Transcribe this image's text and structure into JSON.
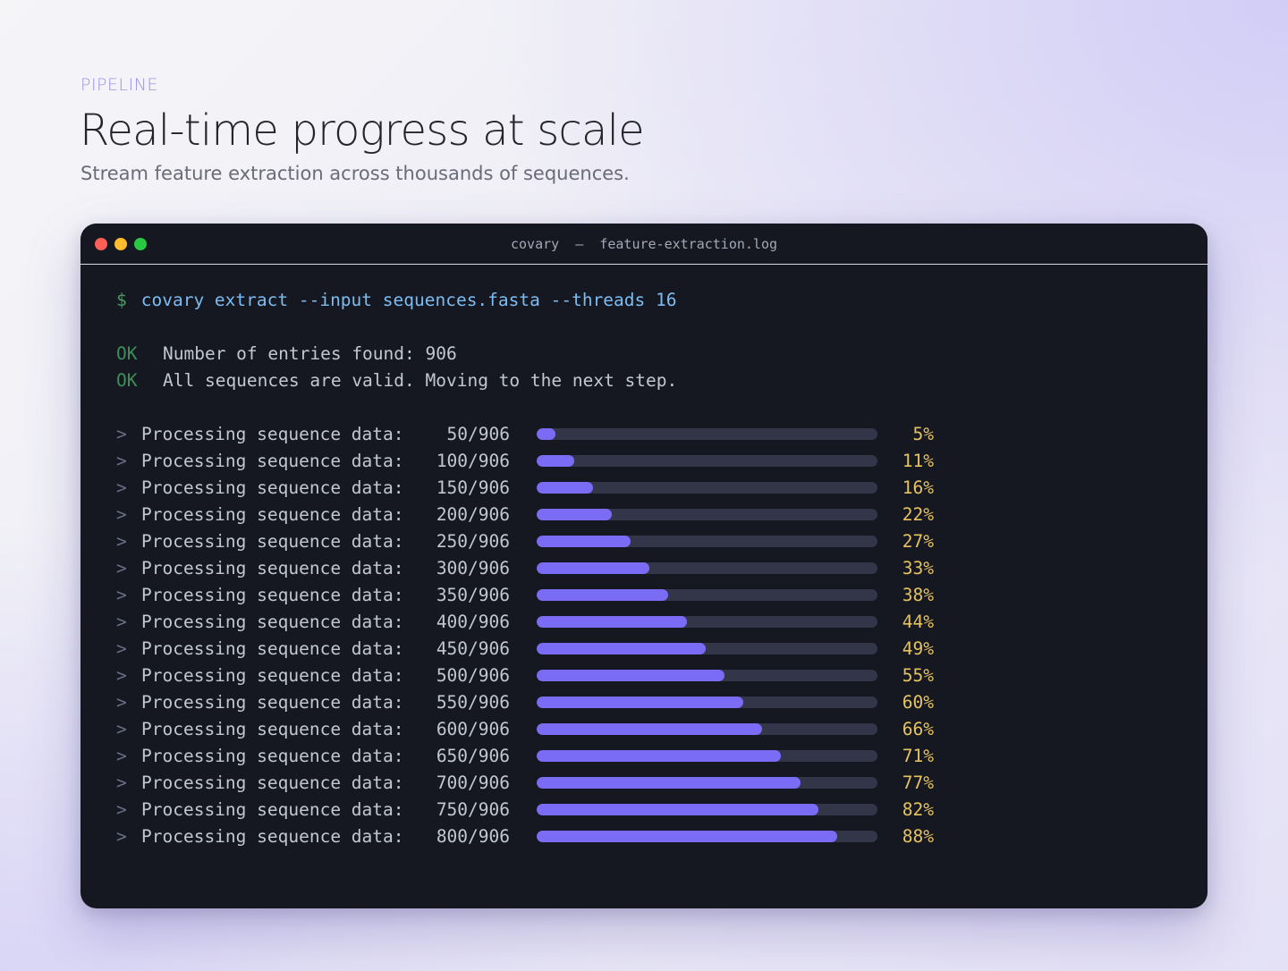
{
  "header": {
    "eyebrow": "PIPELINE",
    "title": "Real-time progress at scale",
    "subtitle": "Stream feature extraction across thousands of sequences."
  },
  "window": {
    "title": "covary  —  feature-extraction.log",
    "controls": [
      "close",
      "minimize",
      "maximize"
    ]
  },
  "terminal": {
    "prompt_symbol": "$",
    "command": "covary extract --input sequences.fasta --threads 16",
    "status_lines": [
      {
        "tag": "OK",
        "text": "Number of entries found: 906"
      },
      {
        "tag": "OK",
        "text": "All sequences are valid. Moving to the next step."
      }
    ],
    "progress_rows": [
      {
        "marker": ">",
        "label": "Processing sequence data:",
        "count": "50/906",
        "percent": "5%",
        "fraction": 0.055
      },
      {
        "marker": ">",
        "label": "Processing sequence data:",
        "count": "100/906",
        "percent": "11%",
        "fraction": 0.11
      },
      {
        "marker": ">",
        "label": "Processing sequence data:",
        "count": "150/906",
        "percent": "16%",
        "fraction": 0.166
      },
      {
        "marker": ">",
        "label": "Processing sequence data:",
        "count": "200/906",
        "percent": "22%",
        "fraction": 0.221
      },
      {
        "marker": ">",
        "label": "Processing sequence data:",
        "count": "250/906",
        "percent": "27%",
        "fraction": 0.276
      },
      {
        "marker": ">",
        "label": "Processing sequence data:",
        "count": "300/906",
        "percent": "33%",
        "fraction": 0.331
      },
      {
        "marker": ">",
        "label": "Processing sequence data:",
        "count": "350/906",
        "percent": "38%",
        "fraction": 0.386
      },
      {
        "marker": ">",
        "label": "Processing sequence data:",
        "count": "400/906",
        "percent": "44%",
        "fraction": 0.442
      },
      {
        "marker": ">",
        "label": "Processing sequence data:",
        "count": "450/906",
        "percent": "49%",
        "fraction": 0.497
      },
      {
        "marker": ">",
        "label": "Processing sequence data:",
        "count": "500/906",
        "percent": "55%",
        "fraction": 0.552
      },
      {
        "marker": ">",
        "label": "Processing sequence data:",
        "count": "550/906",
        "percent": "60%",
        "fraction": 0.607
      },
      {
        "marker": ">",
        "label": "Processing sequence data:",
        "count": "600/906",
        "percent": "66%",
        "fraction": 0.662
      },
      {
        "marker": ">",
        "label": "Processing sequence data:",
        "count": "650/906",
        "percent": "71%",
        "fraction": 0.717
      },
      {
        "marker": ">",
        "label": "Processing sequence data:",
        "count": "700/906",
        "percent": "77%",
        "fraction": 0.773
      },
      {
        "marker": ">",
        "label": "Processing sequence data:",
        "count": "750/906",
        "percent": "82%",
        "fraction": 0.828
      },
      {
        "marker": ">",
        "label": "Processing sequence data:",
        "count": "800/906",
        "percent": "88%",
        "fraction": 0.883
      }
    ]
  },
  "colors": {
    "accent": "#7b6cf6",
    "track": "#333649",
    "percent_text": "#e6c35f",
    "ok_text": "#3e8e5b",
    "command_text": "#7cbcf2",
    "terminal_bg": "#151821"
  }
}
